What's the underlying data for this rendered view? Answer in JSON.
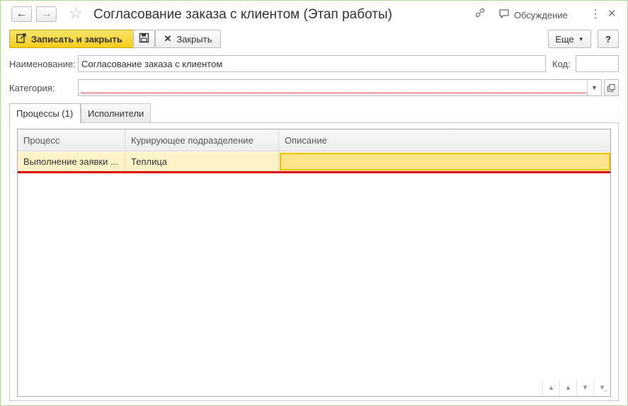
{
  "window": {
    "title": "Согласование заказа с клиентом (Этап работы)",
    "discuss_label": "Обсуждение"
  },
  "toolbar": {
    "save_close_label": "Записать и закрыть",
    "close_label": "Закрыть",
    "more_label": "Еще",
    "help_label": "?"
  },
  "form": {
    "name_label": "Наименование:",
    "name_value": "Согласование заказа с клиентом",
    "code_label": "Код:",
    "code_value": "",
    "category_label": "Категория:",
    "category_value": ""
  },
  "tabs": [
    {
      "label": "Процессы (1)"
    },
    {
      "label": "Исполнители"
    }
  ],
  "table": {
    "columns": [
      "Процесс",
      "Курирующее подразделение",
      "Описание"
    ],
    "rows": [
      {
        "process": "Выполнение заявки ...",
        "department": "Теплица",
        "description": ""
      }
    ]
  },
  "colors": {
    "primary_button": "#f4cc1c",
    "selected_row": "#fdf3c6",
    "active_cell": "#fde38c",
    "error_line": "#e20000"
  }
}
